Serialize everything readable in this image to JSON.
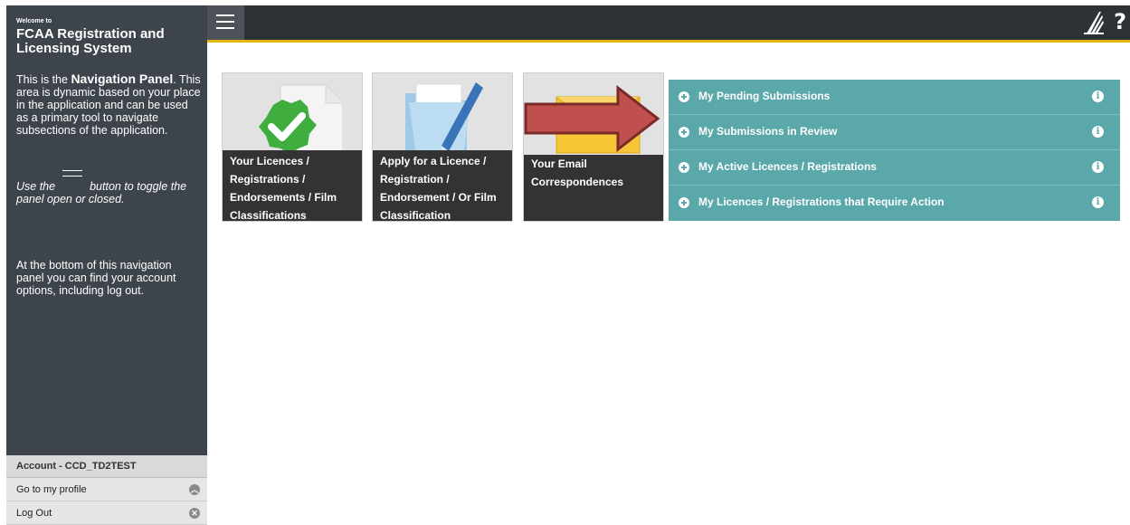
{
  "sidebar": {
    "welcome": "Welcome to",
    "title": "FCAA Registration and Licensing System",
    "para1_prefix": "This is the ",
    "para1_highlight": "Navigation Panel",
    "para1_suffix": ". This area is dynamic based on your place in the application and can be used as a primary tool to navigate subsections of the application.",
    "toggle_prefix": "Use the",
    "toggle_suffix": "button to toggle the panel open or closed.",
    "para3": "At the bottom of this navigation panel you can find your account options, including log out.",
    "account": {
      "header": "Account - CCD_TD2TEST",
      "profile_label": "Go to my profile",
      "logout_label": "Log Out"
    }
  },
  "topbar": {
    "menu_icon": "hamburger-icon",
    "logo_icon": "saskatchewan-logo",
    "help_label": "?",
    "accent_color": "#e4b50f"
  },
  "tiles": [
    {
      "caption": "Your Licences / Registrations / Endorsements / Film Classifications",
      "icon": "checkmark-document-icon"
    },
    {
      "caption": "Apply for a Licence / Registration / Endorsement / Or Film Classification",
      "icon": "folder-pen-icon"
    },
    {
      "caption": "Your Email Correspondences",
      "icon": "envelope-icon"
    }
  ],
  "accordion": {
    "color": "#5ba8ab",
    "items": [
      {
        "label": "My Pending Submissions"
      },
      {
        "label": "My Submissions in Review"
      },
      {
        "label": "My Active Licences / Registrations"
      },
      {
        "label": "My Licences / Registrations that Require Action"
      }
    ]
  },
  "annotation": {
    "arrow_color": "#c0504d"
  }
}
